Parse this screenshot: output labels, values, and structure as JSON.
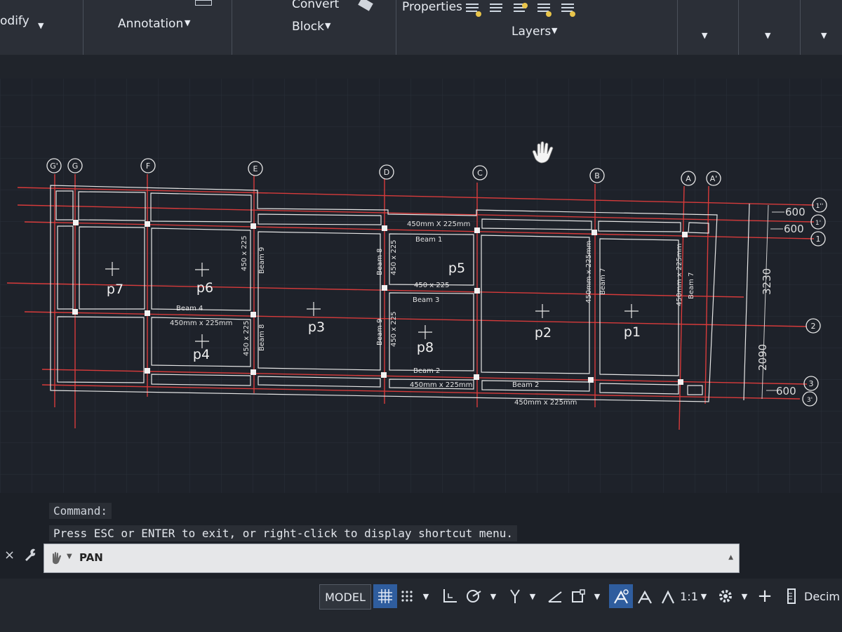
{
  "ribbon": {
    "panel_modify": "odify",
    "panel_annotation": "Annotation",
    "convert_label": "Convert",
    "panel_block": "Block",
    "properties_label": "Properties",
    "panel_layers": "Layers"
  },
  "drawing": {
    "grid_letters": [
      "G'",
      "G",
      "F",
      "E",
      "D",
      "C",
      "B",
      "A",
      "A'"
    ],
    "grid_numbers": [
      "1''",
      "1'",
      "1",
      "2",
      "3",
      "3'"
    ],
    "panels": [
      "p7",
      "p6",
      "p5",
      "p3",
      "p4",
      "p8",
      "p2",
      "p1"
    ],
    "beam_1": "Beam 1",
    "beam_2": "Beam 2",
    "beam_3": "Beam 3",
    "beam_4": "Beam 4",
    "beam_7": "Beam 7",
    "beam_8": "Beam 8",
    "beam_9": "Beam 9",
    "dim_450x225mm_upper": "450mm X 225mm",
    "dim_450x225mm": "450mm x 225mm",
    "dim_450x225": "450 x 225",
    "dims_right": [
      "600",
      "600",
      "3230",
      "2090",
      "600"
    ]
  },
  "command": {
    "label": "Command:",
    "message": "Press ESC or ENTER to exit, or right-click to display shortcut menu.",
    "current": "PAN"
  },
  "status": {
    "model": "MODEL",
    "scale": "1:1",
    "units": "Decim"
  }
}
